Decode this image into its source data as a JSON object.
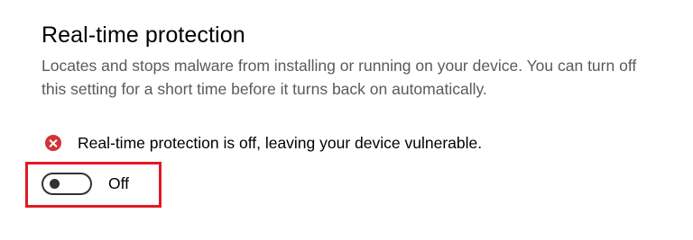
{
  "section": {
    "title": "Real-time protection",
    "description": "Locates and stops malware from installing or running on your device. You can turn off this setting for a short time before it turns back on automatically."
  },
  "warning": {
    "icon": "error-circle-icon",
    "color": "#d13438",
    "text": "Real-time protection is off, leaving your device vulnerable."
  },
  "toggle": {
    "state": false,
    "label": "Off"
  },
  "highlight": {
    "color": "#e01a23"
  }
}
